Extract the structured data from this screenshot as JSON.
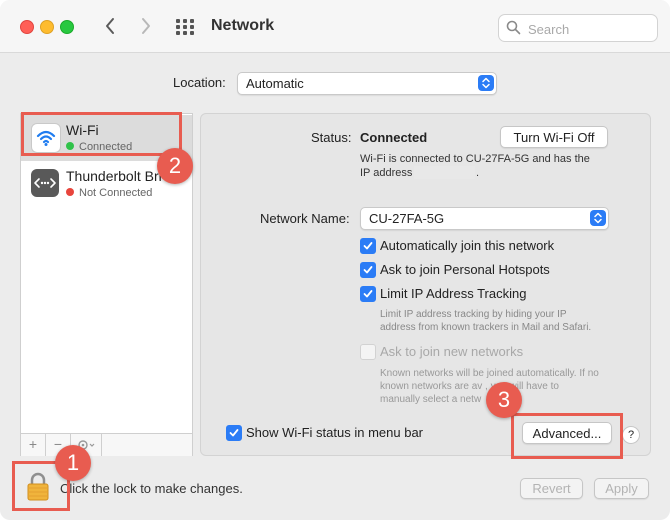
{
  "window": {
    "title": "Network"
  },
  "titlebar": {
    "back_icon": "chevron-left-icon",
    "forward_icon": "chevron-right-icon",
    "grid_icon": "show-all-grid-icon"
  },
  "search": {
    "placeholder": "Search",
    "value": ""
  },
  "location": {
    "label": "Location:",
    "value": "Automatic"
  },
  "services": [
    {
      "name": "Wi-Fi",
      "status": "Connected",
      "status_color": "#30c24a",
      "icon": "wifi-icon"
    },
    {
      "name": "Thunderbolt Bri",
      "status": "Not Connected",
      "status_color": "#e8453c",
      "icon": "thunderbolt-bridge-icon"
    }
  ],
  "sidebar_footer": {
    "add": "+",
    "remove": "−",
    "actions_icon": "gear-icon"
  },
  "detail": {
    "status_label": "Status:",
    "status_value": "Connected",
    "turn_off_button": "Turn Wi-Fi Off",
    "status_desc_line1": "Wi-Fi is connected to CU-27FA-5G and has the",
    "status_desc_line2": "IP address",
    "status_desc_end": ".",
    "network_name_label": "Network Name:",
    "network_name_value": "CU-27FA-5G",
    "checkboxes": [
      {
        "label": "Automatically join this network",
        "checked": true
      },
      {
        "label": "Ask to join Personal Hotspots",
        "checked": true
      },
      {
        "label": "Limit IP Address Tracking",
        "checked": true
      },
      {
        "label": "Ask to join new networks",
        "checked": false,
        "disabled": true
      }
    ],
    "limit_ip_desc_line1": "Limit IP address tracking by hiding your IP",
    "limit_ip_desc_line2": "address from known trackers in Mail and Safari.",
    "ask_new_desc_line1": "Known networks will be joined automatically. If no",
    "ask_new_desc_line2": "known networks are av   , you will have to",
    "ask_new_desc_line3": "manually select a netw",
    "show_status_label": "Show Wi-Fi status in menu bar",
    "advanced_button": "Advanced...",
    "help_button": "?"
  },
  "footer": {
    "lock_text": "Click the lock to make changes.",
    "revert_button": "Revert",
    "apply_button": "Apply"
  },
  "annotations": {
    "badge1": "1",
    "badge2": "2",
    "badge3": "3",
    "color": "#e85c50"
  },
  "colors": {
    "accent": "#2b7cf6",
    "annotation": "#e85c50",
    "connected": "#30c24a",
    "not_connected": "#e8453c"
  }
}
